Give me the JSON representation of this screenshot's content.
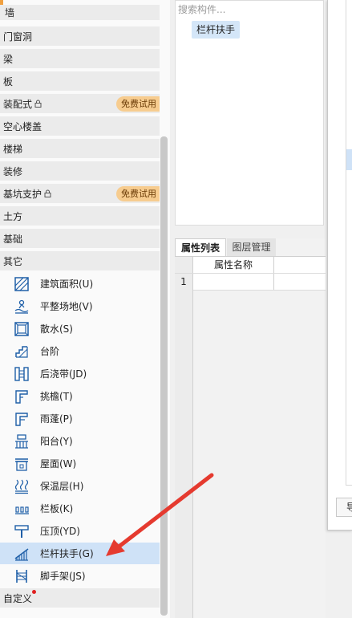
{
  "categories": [
    {
      "label": "墙"
    },
    {
      "label": "门窗洞"
    },
    {
      "label": "梁"
    },
    {
      "label": "板"
    },
    {
      "label": "装配式",
      "locked": true,
      "badge": "免费试用"
    },
    {
      "label": "空心楼盖"
    },
    {
      "label": "楼梯"
    },
    {
      "label": "装修"
    },
    {
      "label": "基坑支护",
      "locked": true,
      "badge": "免费试用"
    },
    {
      "label": "土方"
    },
    {
      "label": "基础"
    },
    {
      "label": "其它"
    }
  ],
  "other_items": [
    {
      "label": "建筑面积(U)",
      "icon": "building-area-icon"
    },
    {
      "label": "平整场地(V)",
      "icon": "site-leveling-icon"
    },
    {
      "label": "散水(S)",
      "icon": "apron-icon"
    },
    {
      "label": "台阶(",
      "icon": "steps-icon",
      "full": "台阶"
    },
    {
      "label": "后浇带(JD)",
      "icon": "post-pour-strip-icon"
    },
    {
      "label": "挑檐(T)",
      "icon": "cornice-icon"
    },
    {
      "label": "雨蓬(P)",
      "icon": "canopy-icon"
    },
    {
      "label": "阳台(Y)",
      "icon": "balcony-icon"
    },
    {
      "label": "屋面(W)",
      "icon": "roof-icon"
    },
    {
      "label": "保温层(H)",
      "icon": "insulation-layer-icon"
    },
    {
      "label": "栏板(K)",
      "icon": "parapet-panel-icon"
    },
    {
      "label": "压顶(YD)",
      "icon": "coping-icon"
    },
    {
      "label": "栏杆扶手(G)",
      "icon": "railing-handrail-icon",
      "selected": true
    },
    {
      "label": "脚手架(JS)",
      "icon": "scaffold-icon"
    }
  ],
  "custom_category": {
    "label": "自定义"
  },
  "search": {
    "placeholder": "搜索构件..."
  },
  "component_chip": "栏杆扶手",
  "props": {
    "tab_attr": "属性列表",
    "tab_layer": "图层管理",
    "col_name": "属性名称",
    "row_1": "1"
  },
  "right_dialog": {
    "button_label": "导"
  },
  "colors": {
    "selected": "#cfe2f7",
    "badge": "#f7cc8f",
    "arrow": "#e53a2f",
    "accent": "#f0a040"
  }
}
